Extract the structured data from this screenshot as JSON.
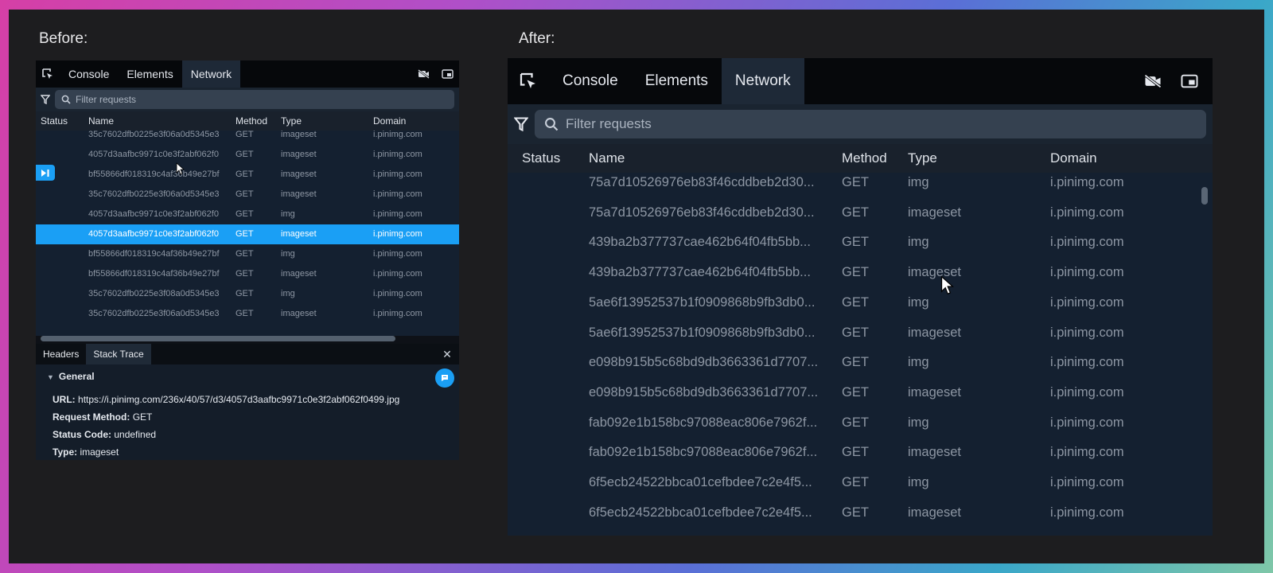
{
  "captions": {
    "before": "Before:",
    "after": "After:"
  },
  "tabs": [
    "Console",
    "Elements",
    "Network"
  ],
  "filter_placeholder": "Filter requests",
  "columns": {
    "status": "Status",
    "name": "Name",
    "method": "Method",
    "type": "Type",
    "domain": "Domain"
  },
  "before_rows": [
    {
      "name": "35c7602dfb0225e3f06a0d5345e3",
      "method": "GET",
      "type": "imageset",
      "domain": "i.pinimg.com"
    },
    {
      "name": "4057d3aafbc9971c0e3f2abf062f0",
      "method": "GET",
      "type": "imageset",
      "domain": "i.pinimg.com"
    },
    {
      "name": "bf55866df018319c4af36b49e27bf",
      "method": "GET",
      "type": "imageset",
      "domain": "i.pinimg.com"
    },
    {
      "name": "35c7602dfb0225e3f06a0d5345e3",
      "method": "GET",
      "type": "imageset",
      "domain": "i.pinimg.com"
    },
    {
      "name": "4057d3aafbc9971c0e3f2abf062f0",
      "method": "GET",
      "type": "img",
      "domain": "i.pinimg.com"
    },
    {
      "name": "4057d3aafbc9971c0e3f2abf062f0",
      "method": "GET",
      "type": "imageset",
      "domain": "i.pinimg.com"
    },
    {
      "name": "bf55866df018319c4af36b49e27bf",
      "method": "GET",
      "type": "img",
      "domain": "i.pinimg.com"
    },
    {
      "name": "bf55866df018319c4af36b49e27bf",
      "method": "GET",
      "type": "imageset",
      "domain": "i.pinimg.com"
    },
    {
      "name": "35c7602dfb0225e3f08a0d5345e3",
      "method": "GET",
      "type": "img",
      "domain": "i.pinimg.com"
    },
    {
      "name": "35c7602dfb0225e3f06a0d5345e3",
      "method": "GET",
      "type": "imageset",
      "domain": "i.pinimg.com"
    }
  ],
  "before_selected_row": 5,
  "detail_tabs": [
    "Headers",
    "Stack Trace"
  ],
  "details": {
    "section": "General",
    "url_label": "URL:",
    "url": "https://i.pinimg.com/236x/40/57/d3/4057d3aafbc9971c0e3f2abf062f0499.jpg",
    "method_label": "Request Method:",
    "method": "GET",
    "status_label": "Status Code:",
    "status": "undefined",
    "type_label": "Type:",
    "type": "imageset"
  },
  "after_rows": [
    {
      "name": "75a7d10526976eb83f46cddbeb2d30...",
      "method": "GET",
      "type": "img",
      "domain": "i.pinimg.com"
    },
    {
      "name": "75a7d10526976eb83f46cddbeb2d30...",
      "method": "GET",
      "type": "imageset",
      "domain": "i.pinimg.com"
    },
    {
      "name": "439ba2b377737cae462b64f04fb5bb...",
      "method": "GET",
      "type": "img",
      "domain": "i.pinimg.com"
    },
    {
      "name": "439ba2b377737cae462b64f04fb5bb...",
      "method": "GET",
      "type": "imageset",
      "domain": "i.pinimg.com"
    },
    {
      "name": "5ae6f13952537b1f0909868b9fb3db0...",
      "method": "GET",
      "type": "img",
      "domain": "i.pinimg.com"
    },
    {
      "name": "5ae6f13952537b1f0909868b9fb3db0...",
      "method": "GET",
      "type": "imageset",
      "domain": "i.pinimg.com"
    },
    {
      "name": "e098b915b5c68bd9db3663361d7707...",
      "method": "GET",
      "type": "img",
      "domain": "i.pinimg.com"
    },
    {
      "name": "e098b915b5c68bd9db3663361d7707...",
      "method": "GET",
      "type": "imageset",
      "domain": "i.pinimg.com"
    },
    {
      "name": "fab092e1b158bc97088eac806e7962f...",
      "method": "GET",
      "type": "img",
      "domain": "i.pinimg.com"
    },
    {
      "name": "fab092e1b158bc97088eac806e7962f...",
      "method": "GET",
      "type": "imageset",
      "domain": "i.pinimg.com"
    },
    {
      "name": "6f5ecb24522bbca01cefbdee7c2e4f5...",
      "method": "GET",
      "type": "img",
      "domain": "i.pinimg.com"
    },
    {
      "name": "6f5ecb24522bbca01cefbdee7c2e4f5...",
      "method": "GET",
      "type": "imageset",
      "domain": "i.pinimg.com"
    }
  ],
  "icons": {
    "inspect": "cursor-select-icon",
    "filter": "filter-icon",
    "search": "search-icon",
    "video_off": "video-off-icon",
    "pip": "picture-in-picture-icon",
    "close": "close-icon",
    "chat": "chat-icon",
    "play": "play-icon"
  },
  "colors": {
    "accent": "#1a9ff5",
    "panel": "#0e1117",
    "tab_active": "#1e2937"
  }
}
